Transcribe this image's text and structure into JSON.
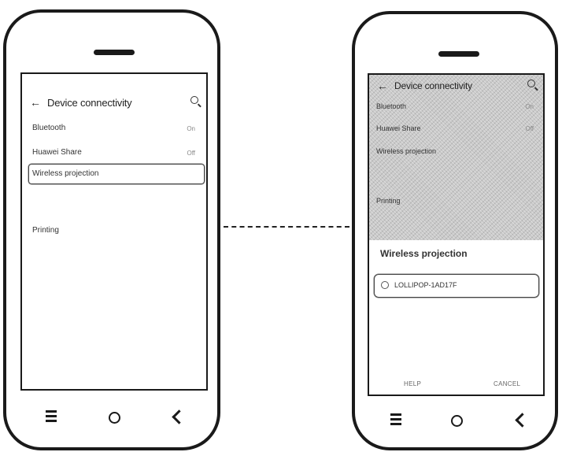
{
  "left_phone": {
    "title": "Device connectivity",
    "items": [
      {
        "label": "Bluetooth",
        "value": "On"
      },
      {
        "label": "Huawei Share",
        "value": "Off"
      },
      {
        "label": "Wireless projection",
        "value": ""
      },
      {
        "label": "Printing",
        "value": ""
      }
    ]
  },
  "right_phone": {
    "title": "Device connectivity",
    "items": [
      {
        "label": "Bluetooth",
        "value": "On"
      },
      {
        "label": "Huawei Share",
        "value": "Off"
      },
      {
        "label": "Wireless projection",
        "value": ""
      },
      {
        "label": "Printing",
        "value": ""
      }
    ],
    "dialog": {
      "title": "Wireless projection",
      "device": "LOLLIPOP-1AD17F",
      "help_label": "HELP",
      "cancel_label": "CANCEL"
    }
  }
}
